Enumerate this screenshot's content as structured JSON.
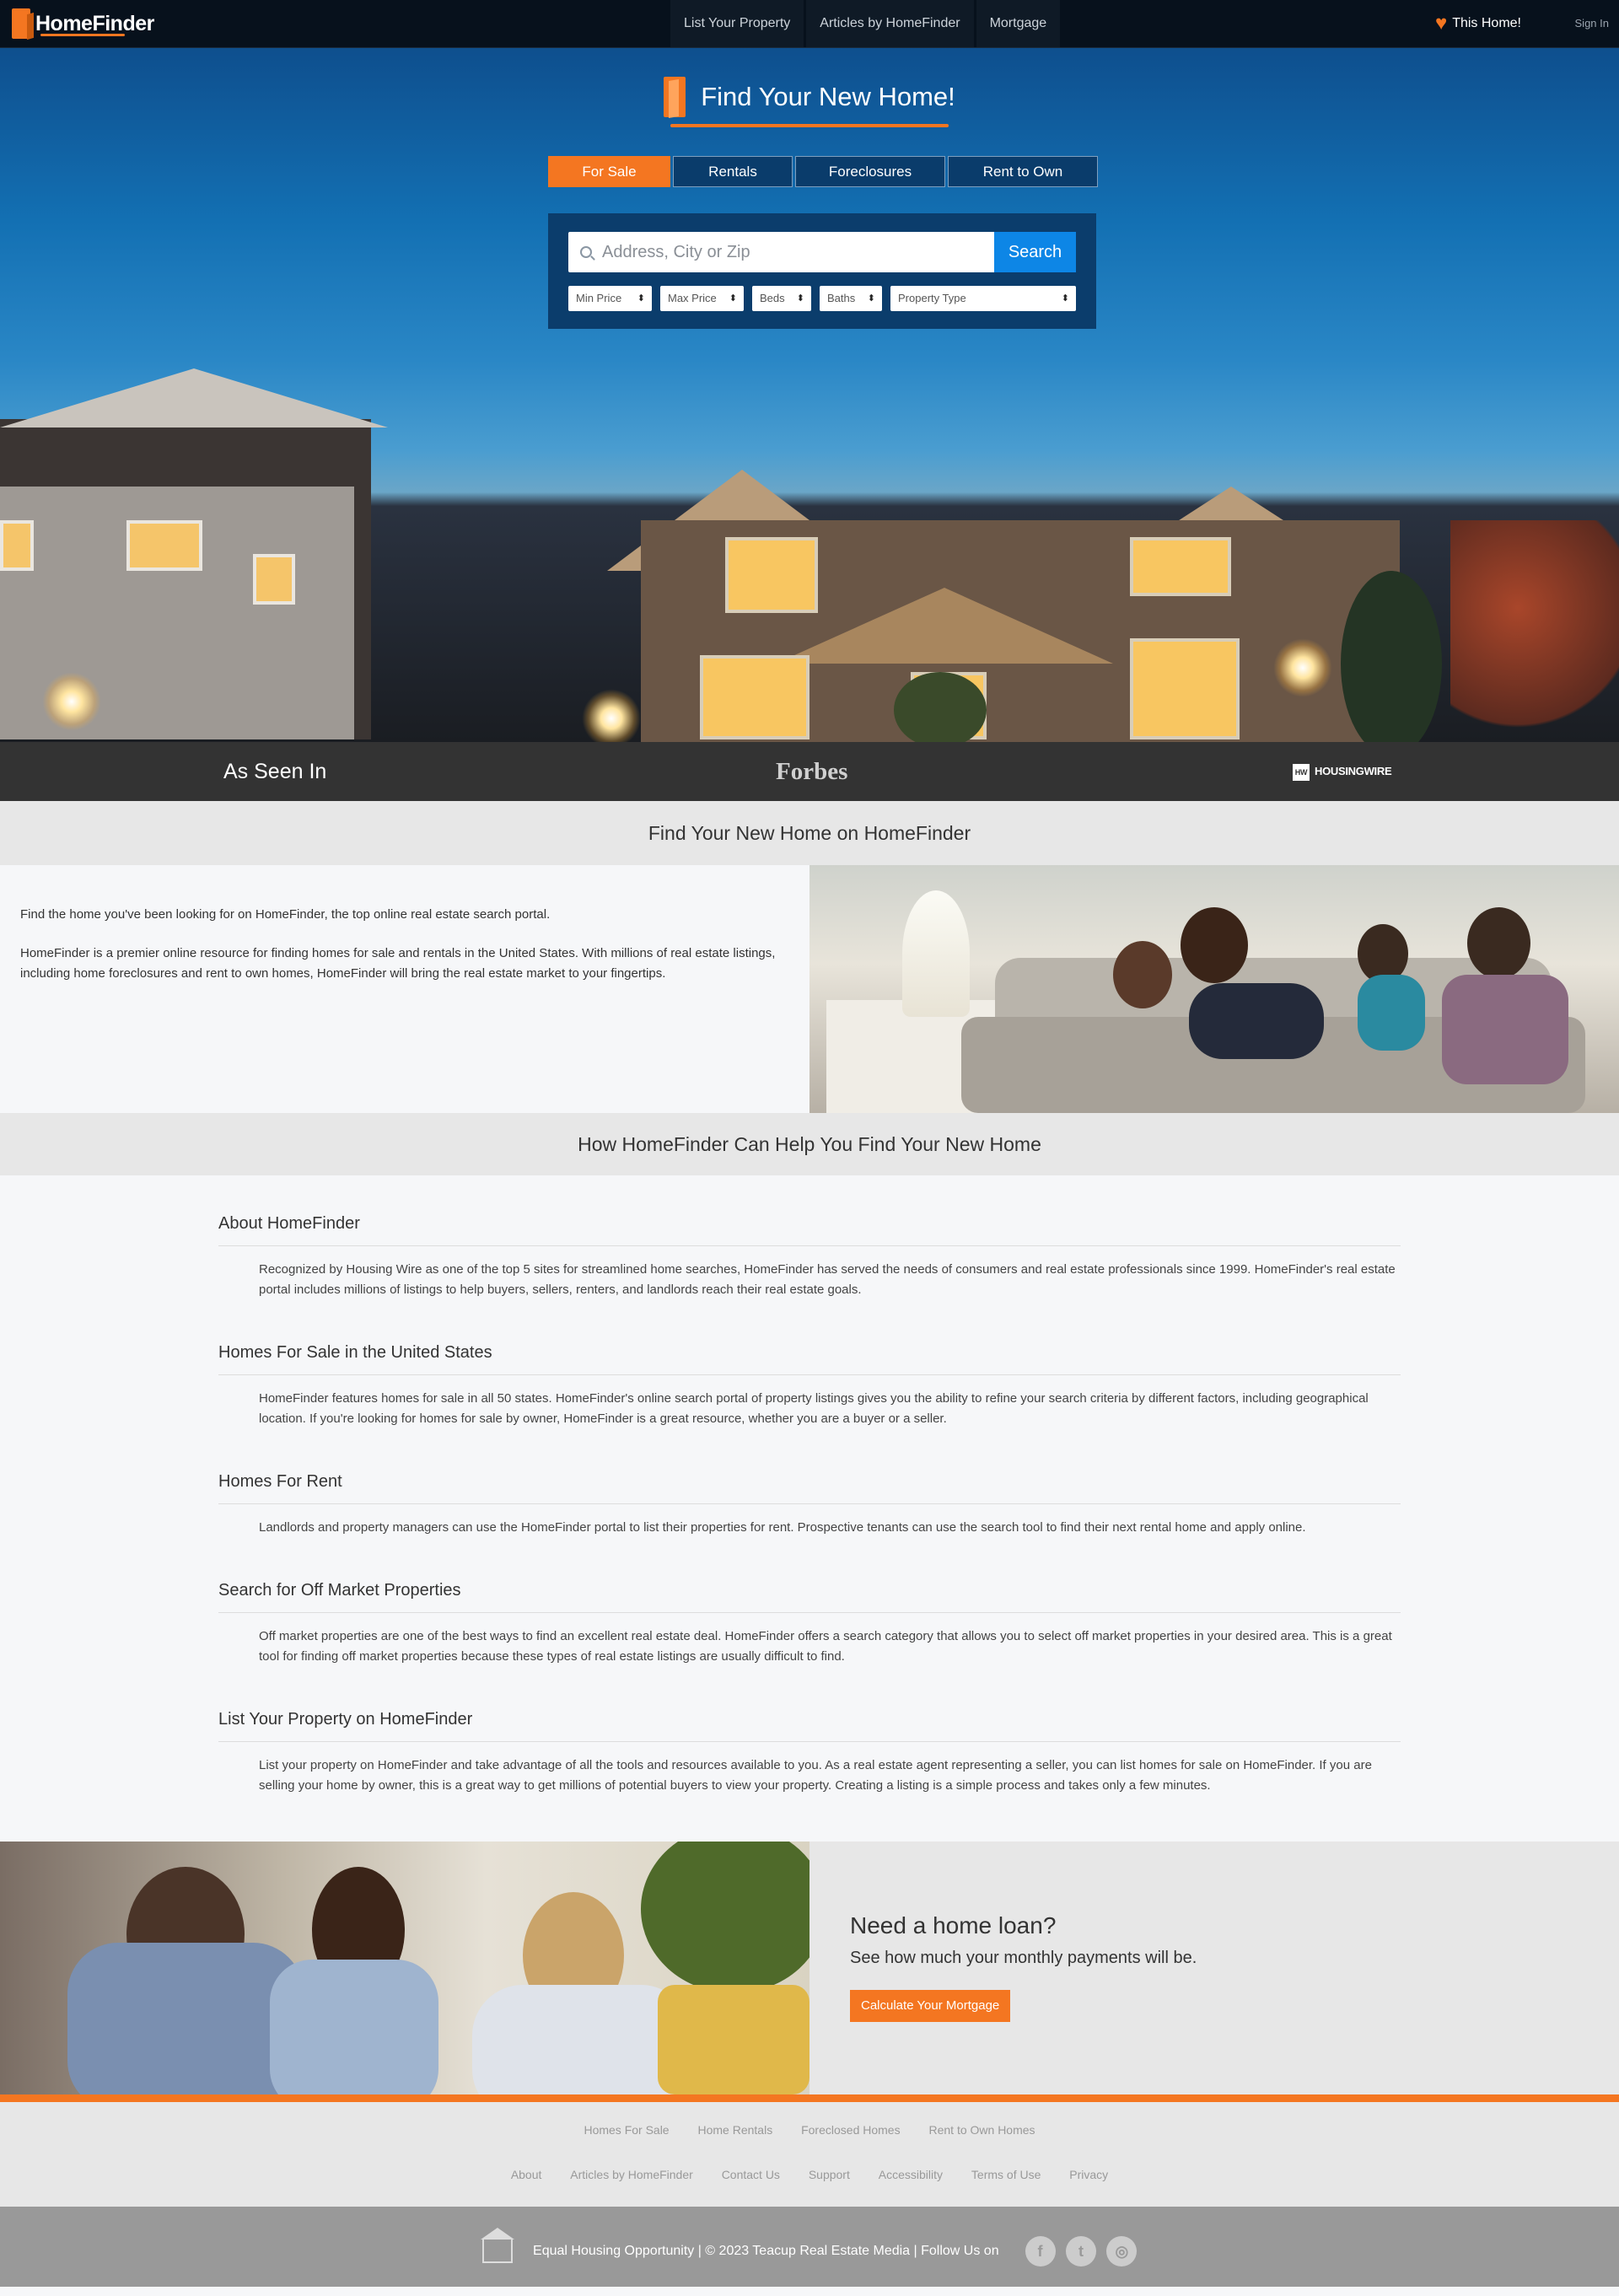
{
  "nav": {
    "brand": "HomeFinder",
    "links": [
      "List Your Property",
      "Articles by HomeFinder",
      "Mortgage"
    ],
    "favorites": "This Home!",
    "sign_in": "Sign In"
  },
  "hero": {
    "title": "Find Your New Home!",
    "tabs": [
      "For Sale",
      "Rentals",
      "Foreclosures",
      "Rent to Own"
    ],
    "active_tab": "For Sale",
    "search_placeholder": "Address, City or Zip",
    "search_button": "Search",
    "filters": [
      "Min Price",
      "Max Price",
      "Beds",
      "Baths",
      "Property Type"
    ]
  },
  "seen_in": {
    "label": "As Seen In",
    "logos": [
      "Forbes",
      "HOUSINGWIRE"
    ],
    "hw_badge": "HW"
  },
  "intro": {
    "heading": "Find Your New Home on HomeFinder",
    "paragraphs": [
      "Find the home you've been looking for on HomeFinder, the top online real estate search portal.",
      "HomeFinder is a premier online resource for finding homes for sale and rentals in the United States. With millions of real estate listings, including home foreclosures and rent to own homes, HomeFinder will bring the real estate market to your fingertips."
    ]
  },
  "help": {
    "heading": "How HomeFinder Can Help You Find Your New Home",
    "sections": [
      {
        "title": "About HomeFinder",
        "text": "Recognized by Housing Wire as one of the top 5 sites for streamlined home searches, HomeFinder has served the needs of consumers and real estate professionals since 1999. HomeFinder's real estate portal includes millions of listings to help buyers, sellers, renters, and landlords reach their real estate goals."
      },
      {
        "title": "Homes For Sale in the United States",
        "text": "HomeFinder features homes for sale in all 50 states. HomeFinder's online search portal of property listings gives you the ability to refine your search criteria by different factors, including geographical location. If you're looking for homes for sale by owner, HomeFinder is a great resource, whether you are a buyer or a seller."
      },
      {
        "title": "Homes For Rent",
        "text": "Landlords and property managers can use the HomeFinder portal to list their properties for rent. Prospective tenants can use the search tool to find their next rental home and apply online."
      },
      {
        "title": "Search for Off Market Properties",
        "text": "Off market properties are one of the best ways to find an excellent real estate deal. HomeFinder offers a search category that allows you to select off market properties in your desired area. This is a great tool for finding off market properties because these types of real estate listings are usually difficult to find."
      },
      {
        "title": "List Your Property on HomeFinder",
        "text": "List your property on HomeFinder and take advantage of all the tools and resources available to you. As a real estate agent representing a seller, you can list homes for sale on HomeFinder. If you are selling your home by owner, this is a great way to get millions of potential buyers to view your property. Creating a listing is a simple process and takes only a few minutes."
      }
    ]
  },
  "loan": {
    "title": "Need a home loan?",
    "subtitle": "See how much your monthly payments will be.",
    "button": "Calculate Your Mortgage"
  },
  "footer": {
    "row1": [
      "Homes For Sale",
      "Home Rentals",
      "Foreclosed Homes",
      "Rent to Own Homes"
    ],
    "row2": [
      "About",
      "Articles by HomeFinder",
      "Contact Us",
      "Support",
      "Accessibility",
      "Terms of Use",
      "Privacy"
    ],
    "bottom": "Equal Housing Opportunity | © 2023 Teacup Real Estate Media | Follow Us on",
    "social": [
      "f",
      "t",
      "◎"
    ]
  },
  "colors": {
    "accent": "#f47621",
    "nav": "#07111c",
    "search_button": "#0d86e6"
  },
  "icons": [
    "door-logo-icon",
    "heart-icon",
    "search-icon",
    "equal-housing-icon",
    "facebook-icon",
    "twitter-icon",
    "instagram-icon"
  ]
}
